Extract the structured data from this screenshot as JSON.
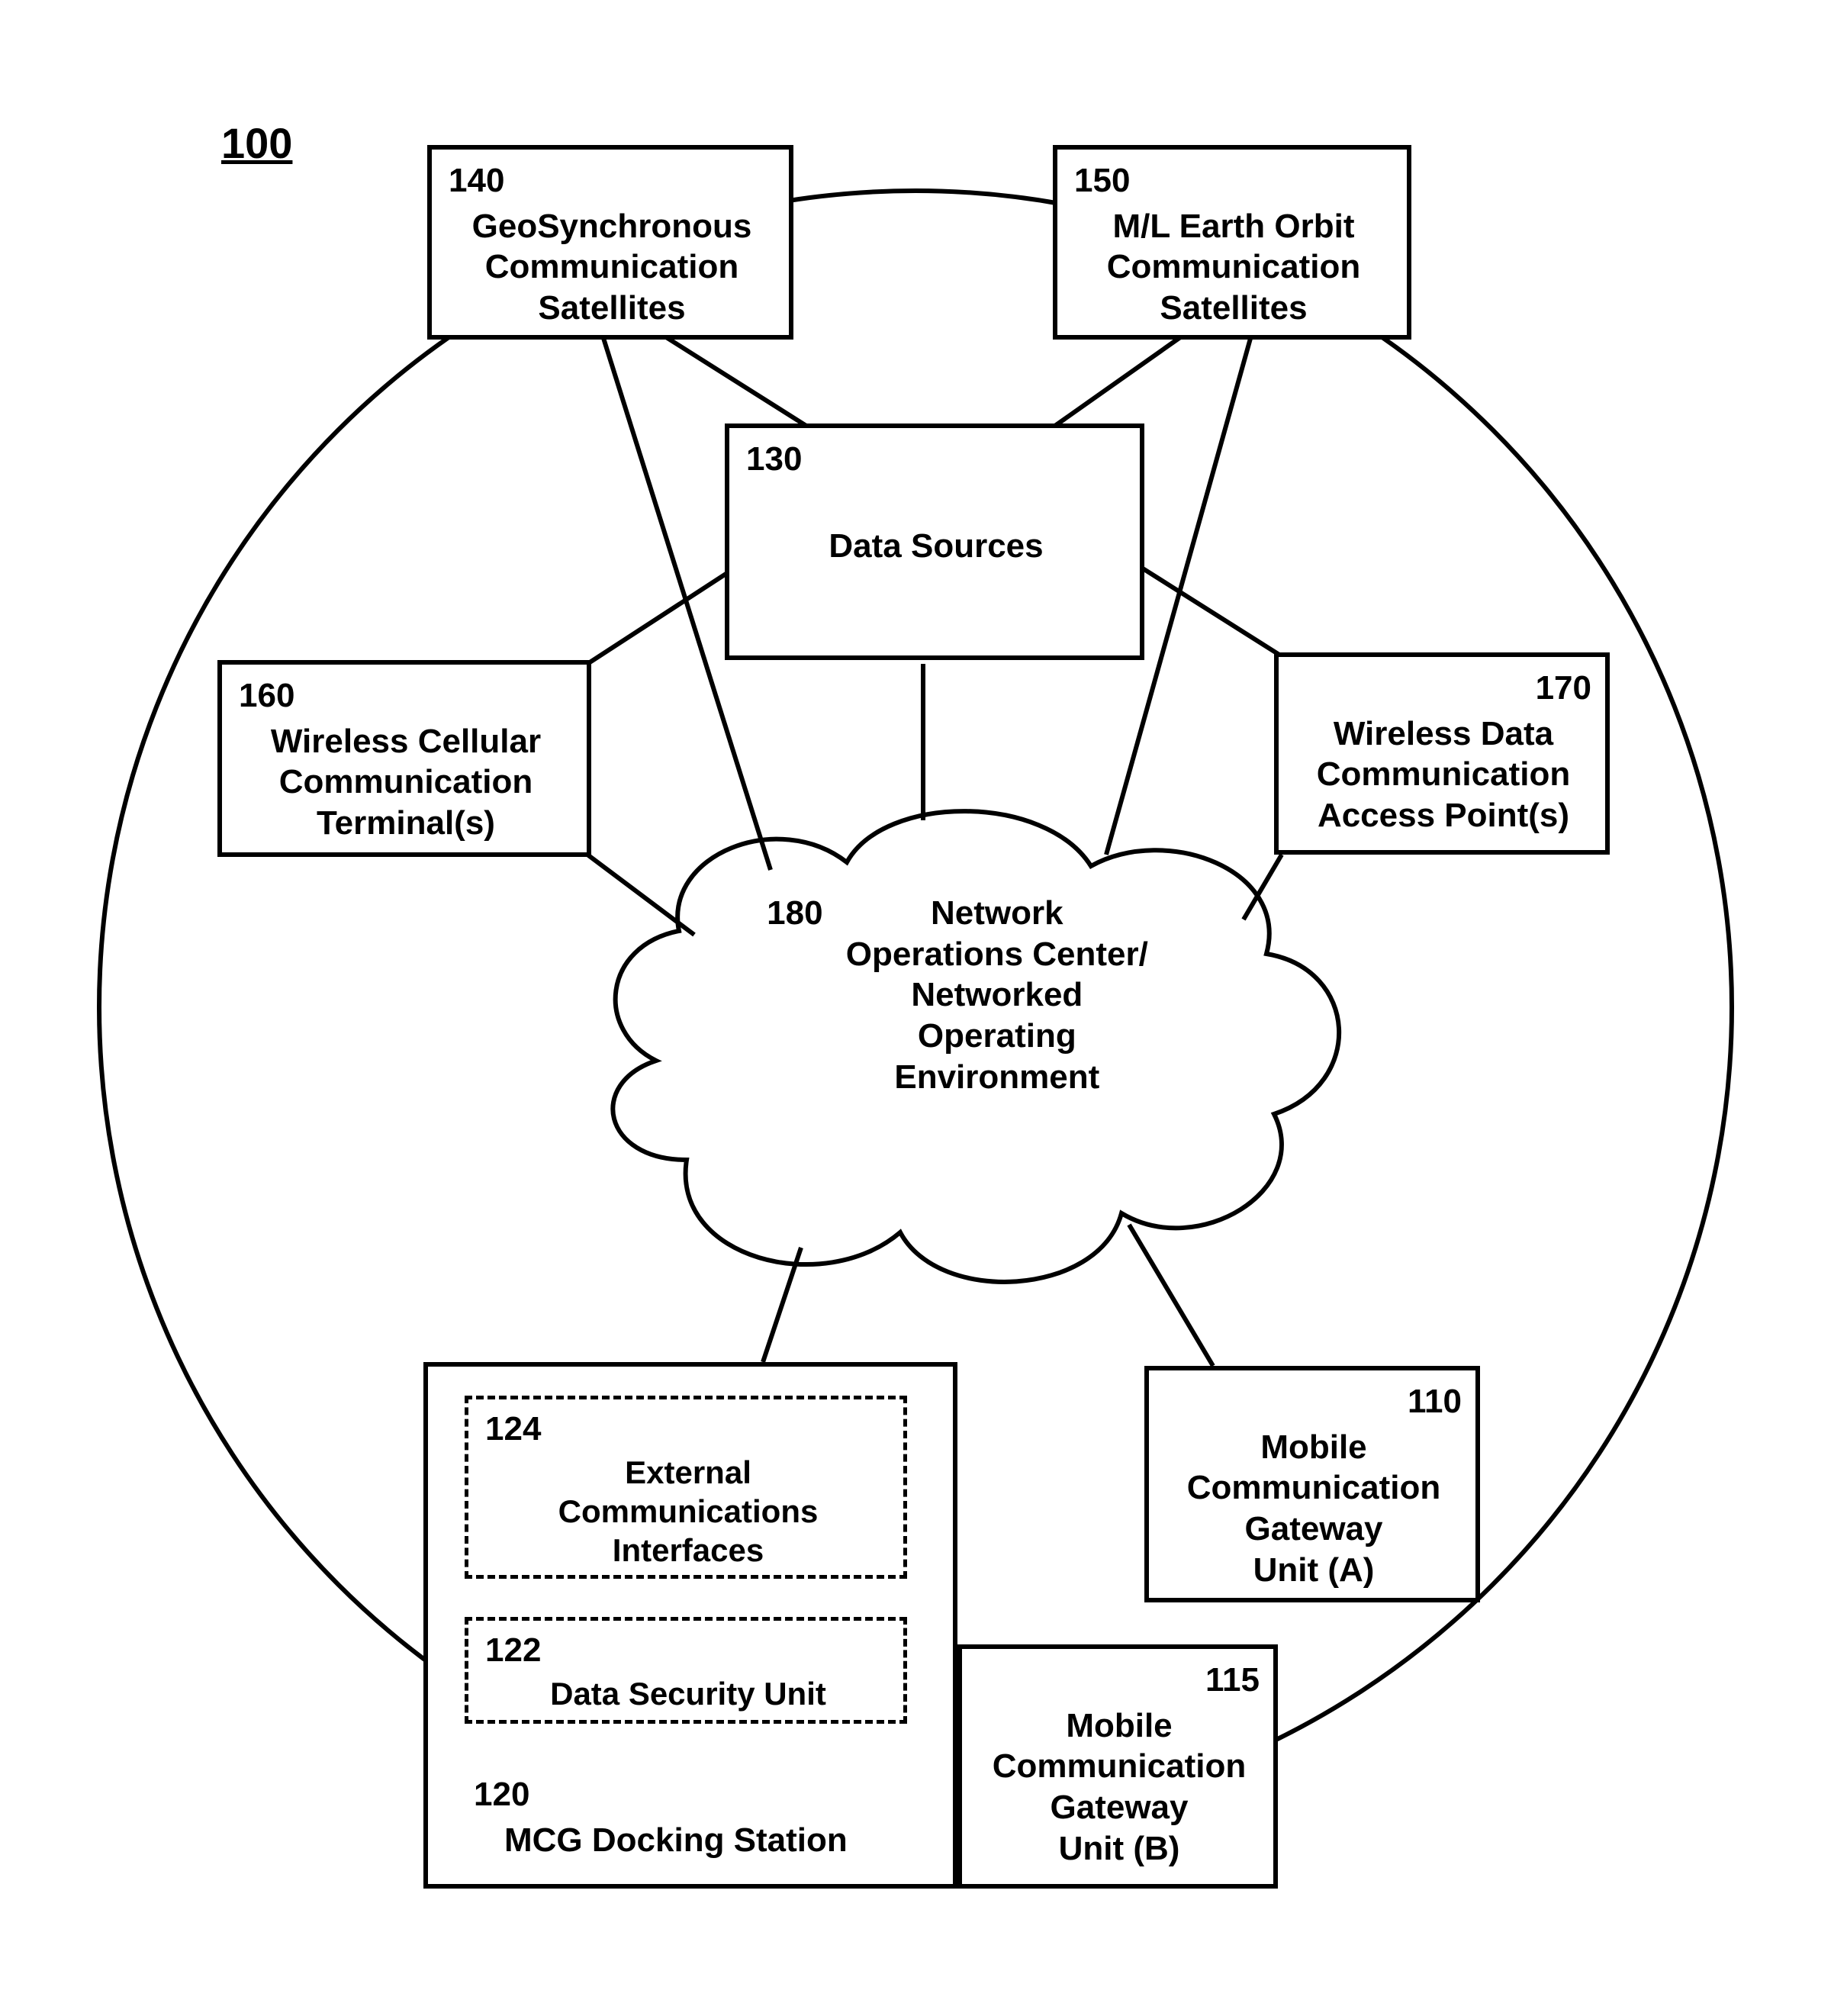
{
  "figure_id": "100",
  "boxes": {
    "b140": {
      "num": "140",
      "label": "GeoSynchronous\nCommunication\nSatellites"
    },
    "b150": {
      "num": "150",
      "label": "M/L Earth Orbit\nCommunication\nSatellites"
    },
    "b130": {
      "num": "130",
      "label": "Data Sources"
    },
    "b160": {
      "num": "160",
      "label": "Wireless Cellular\nCommunication\nTerminal(s)"
    },
    "b170": {
      "num": "170",
      "label": "Wireless Data\nCommunication\nAccess Point(s)"
    },
    "b180": {
      "num": "180",
      "label": "Network\nOperations Center/\nNetworked\nOperating\nEnvironment"
    },
    "b124": {
      "num": "124",
      "label": "External\nCommunications\nInterfaces"
    },
    "b122": {
      "num": "122",
      "label": "Data Security Unit"
    },
    "b120": {
      "num": "120",
      "label": "MCG Docking Station"
    },
    "b110": {
      "num": "110",
      "label": "Mobile\nCommunication\nGateway\nUnit (A)"
    },
    "b115": {
      "num": "115",
      "label": "Mobile\nCommunication\nGateway\nUnit (B)"
    }
  }
}
